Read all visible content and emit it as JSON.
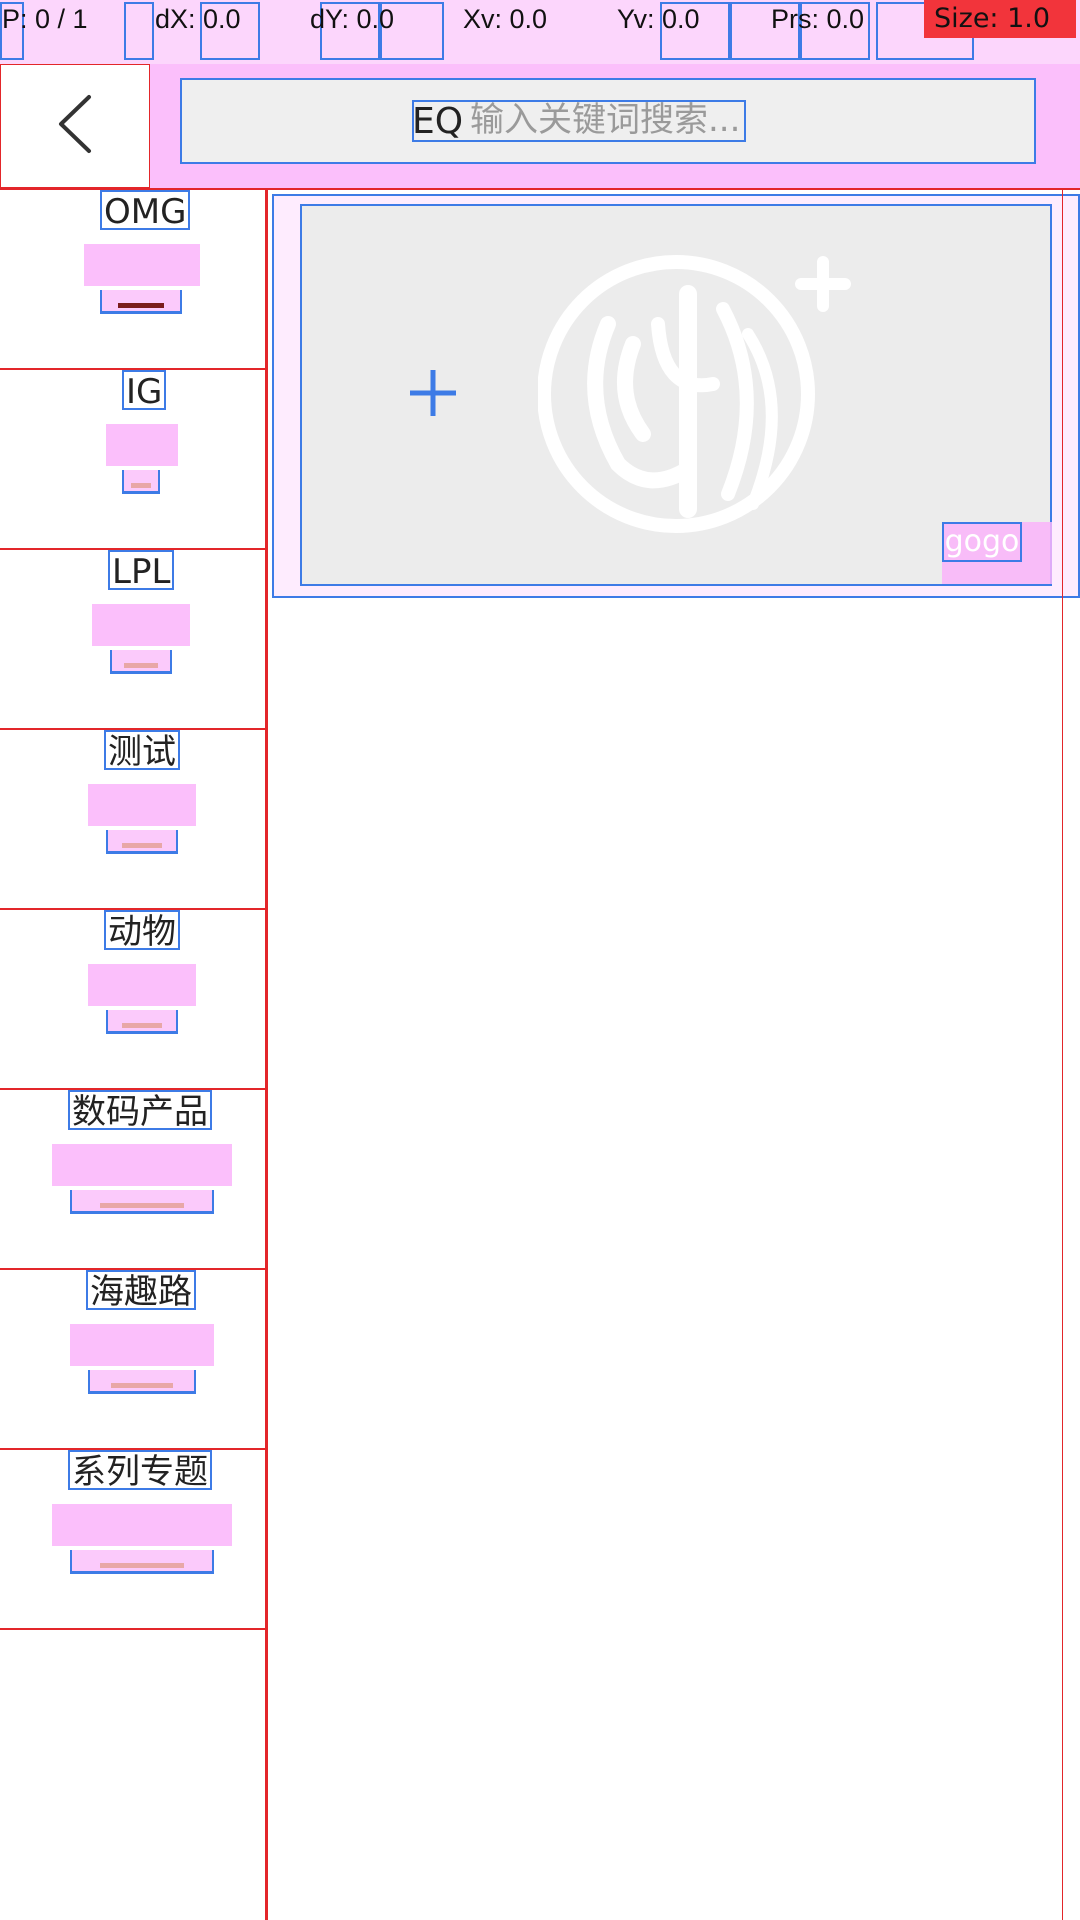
{
  "debug": {
    "pointer": "P: 0 / 1",
    "dx": "dX: 0.0",
    "dy": "dY: 0.0",
    "xv": "Xv: 0.0",
    "yv": "Yv: 0.0",
    "prs": "Prs: 0.0",
    "size": "Size: 1.0"
  },
  "header": {
    "back_icon": "chevron-left-icon",
    "search_icon": "search-icon",
    "search_glyph": "EQ",
    "search_placeholder": "输入关键词搜索..."
  },
  "sidebar": {
    "items": [
      {
        "label": "OMG",
        "active": true
      },
      {
        "label": "IG",
        "active": false
      },
      {
        "label": "LPL",
        "active": false
      },
      {
        "label": "测试",
        "active": false
      },
      {
        "label": "动物",
        "active": false
      },
      {
        "label": "数码产品",
        "active": false
      },
      {
        "label": "海趣路",
        "active": false
      },
      {
        "label": "系列专题",
        "active": false
      }
    ]
  },
  "banner": {
    "add_icon": "plus-icon",
    "logo": "brand-logo",
    "label": "gogo"
  },
  "colors": {
    "accent": "#3d7be6",
    "debug_red": "#e3262a",
    "debug_pink": "#fab4fa",
    "banner_bg": "#ececec"
  }
}
